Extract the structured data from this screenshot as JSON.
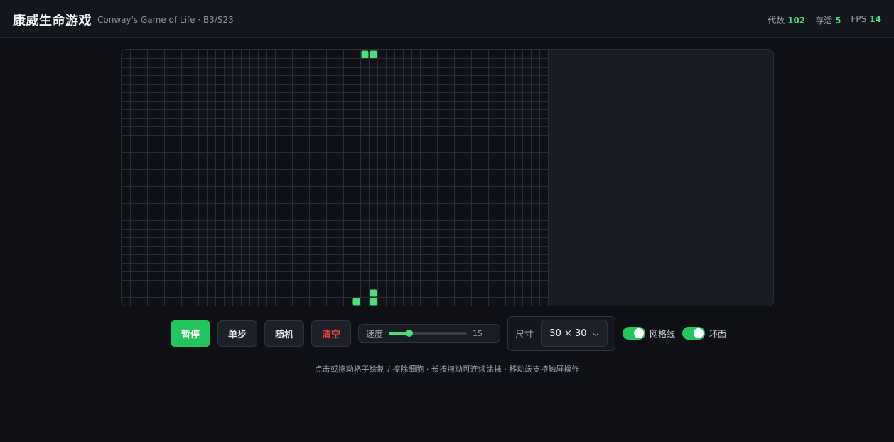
{
  "header": {
    "title": "康威生命游戏",
    "subtitle": "Conway's Game of Life · B3/S23",
    "stats": [
      {
        "label": "代数",
        "value": "102"
      },
      {
        "label": "存活",
        "value": "5"
      },
      {
        "label": "FPS",
        "value": "14"
      }
    ]
  },
  "board": {
    "columns": 50,
    "rows": 30,
    "grid_visible": true,
    "live_color": "#4ade80",
    "live_cells": [
      [
        28,
        0
      ],
      [
        29,
        0
      ],
      [
        29,
        28
      ],
      [
        27,
        29
      ],
      [
        29,
        29
      ]
    ]
  },
  "controls": {
    "pause_label": "暂停",
    "step_label": "单步",
    "random_label": "随机",
    "clear_label": "清空",
    "speed_label": "速度",
    "speed_value": "15",
    "speed_fraction": 0.26,
    "size_label": "尺寸",
    "size_value": "50 × 30",
    "grid_toggle_label": "网格线",
    "wrap_toggle_label": "环面"
  },
  "hint": "点击或拖动格子绘制 / 擦除细胞 · 长按拖动可连续涂抹 · 移动端支持触屏操作",
  "colors": {
    "accent": "#22c55e",
    "danger": "#ef4444",
    "background": "#0e1016"
  }
}
